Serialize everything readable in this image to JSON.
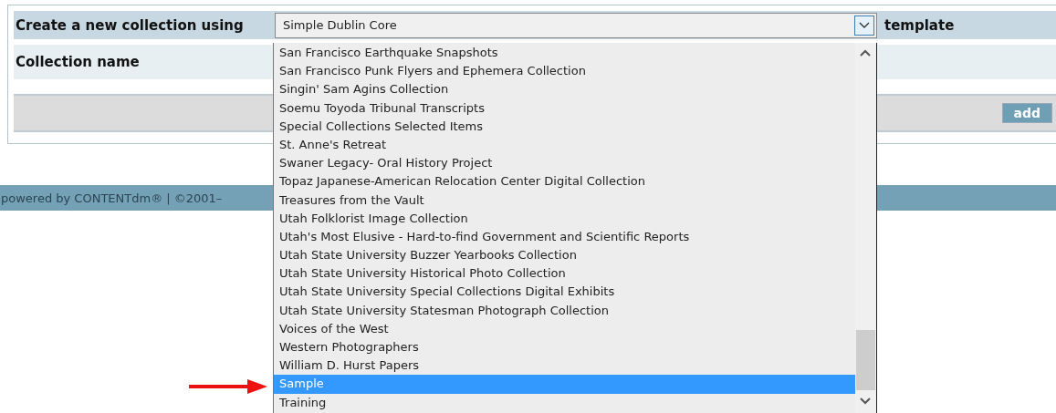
{
  "form": {
    "template_label": "Create a new collection using",
    "template_select": {
      "value": "Simple Dublin Core",
      "expanded": true
    },
    "template_suffix": "template",
    "name_label": "Collection name",
    "add_button": "add"
  },
  "dropdown_options": [
    {
      "label": "San Francisco Earthquake Snapshots",
      "selected": false
    },
    {
      "label": "San Francisco Punk Flyers and Ephemera Collection",
      "selected": false
    },
    {
      "label": "Singin' Sam Agins Collection",
      "selected": false
    },
    {
      "label": "Soemu Toyoda Tribunal Transcripts",
      "selected": false
    },
    {
      "label": "Special Collections Selected Items",
      "selected": false
    },
    {
      "label": "St. Anne's Retreat",
      "selected": false
    },
    {
      "label": "Swaner Legacy- Oral History Project",
      "selected": false
    },
    {
      "label": "Topaz Japanese-American Relocation Center Digital Collection",
      "selected": false
    },
    {
      "label": "Treasures from the Vault",
      "selected": false
    },
    {
      "label": "Utah Folklorist Image Collection",
      "selected": false
    },
    {
      "label": "Utah's Most Elusive - Hard-to-find Government and Scientific Reports",
      "selected": false
    },
    {
      "label": "Utah State University Buzzer Yearbooks Collection",
      "selected": false
    },
    {
      "label": "Utah State University Historical Photo Collection",
      "selected": false
    },
    {
      "label": "Utah State University Special Collections Digital Exhibits",
      "selected": false
    },
    {
      "label": "Utah State University Statesman Photograph Collection",
      "selected": false
    },
    {
      "label": "Voices of the West",
      "selected": false
    },
    {
      "label": "Western Photographers",
      "selected": false
    },
    {
      "label": "William D. Hurst Papers",
      "selected": false
    },
    {
      "label": "Sample",
      "selected": true
    },
    {
      "label": "Training",
      "selected": false
    }
  ],
  "footer": {
    "text": "powered by CONTENTdm® | ©2001–"
  }
}
